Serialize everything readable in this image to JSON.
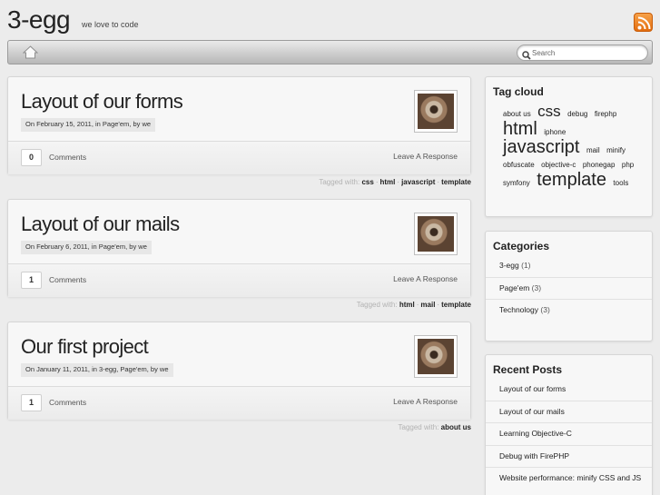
{
  "header": {
    "site_title": "3-egg",
    "tagline": "we love to code"
  },
  "nav": {
    "search_placeholder": "Search"
  },
  "posts": [
    {
      "title": "Layout of our forms",
      "meta": "On February 15, 2011, in Page'em, by we",
      "comment_count": "0",
      "comments_label": "Comments",
      "leave_label": "Leave A Response",
      "tagged_label": "Tagged with:",
      "tags": [
        "css",
        "html",
        "javascript",
        "template"
      ]
    },
    {
      "title": "Layout of our mails",
      "meta": "On February 6, 2011, in Page'em, by we",
      "comment_count": "1",
      "comments_label": "Comments",
      "leave_label": "Leave A Response",
      "tagged_label": "Tagged with:",
      "tags": [
        "html",
        "mail",
        "template"
      ]
    },
    {
      "title": "Our first project",
      "meta": "On January 11, 2011, in 3-egg, Page'em, by we",
      "comment_count": "1",
      "comments_label": "Comments",
      "leave_label": "Leave A Response",
      "tagged_label": "Tagged with:",
      "tags": [
        "about us"
      ]
    }
  ],
  "sidebar": {
    "tag_cloud_title": "Tag cloud",
    "tag_cloud": [
      {
        "label": "about us",
        "size": 8
      },
      {
        "label": "css",
        "size": 17
      },
      {
        "label": "debug",
        "size": 8
      },
      {
        "label": "firephp",
        "size": 8
      },
      {
        "label": "html",
        "size": 20
      },
      {
        "label": "iphone",
        "size": 8
      },
      {
        "label": "javascript",
        "size": 20
      },
      {
        "label": "mail",
        "size": 8
      },
      {
        "label": "minify",
        "size": 8
      },
      {
        "label": "obfuscate",
        "size": 8
      },
      {
        "label": "objective-c",
        "size": 8
      },
      {
        "label": "phonegap",
        "size": 8
      },
      {
        "label": "php",
        "size": 8
      },
      {
        "label": "symfony",
        "size": 8
      },
      {
        "label": "template",
        "size": 20
      },
      {
        "label": "tools",
        "size": 8
      }
    ],
    "categories_title": "Categories",
    "categories": [
      {
        "label": "3-egg",
        "count": "(1)"
      },
      {
        "label": "Page'em",
        "count": "(3)"
      },
      {
        "label": "Technology",
        "count": "(3)"
      }
    ],
    "recent_title": "Recent Posts",
    "recent_posts": [
      "Layout of our forms",
      "Layout of our mails",
      "Learning Objective-C",
      "Debug with FirePHP",
      "Website performance: minify CSS and JS"
    ]
  },
  "colors": {
    "rss": "#f08a24",
    "background": "#ececec"
  }
}
